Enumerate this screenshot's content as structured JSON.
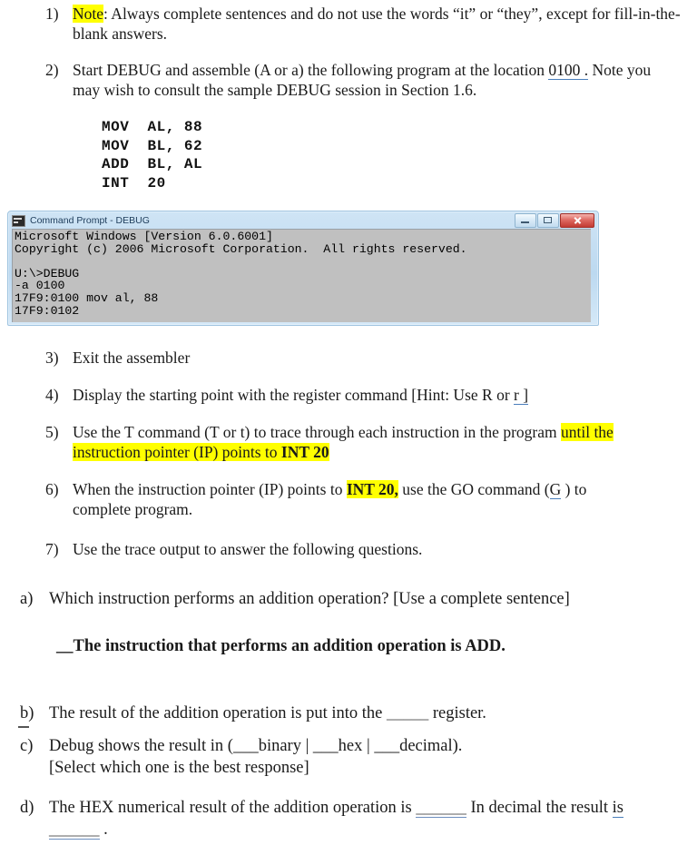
{
  "document": {
    "list_items": [
      {
        "marker": "1)",
        "segments": [
          {
            "text": "Note",
            "style": "highlight"
          },
          {
            "text": ": Always complete sentences and do not use the words “it” or “they”, except for fill-in-the-blank answers.",
            "style": "plain"
          }
        ],
        "line1": "Note: Always complete sentences and do not use the words “it” or “they”, except for fill-",
        "line2": "in-the-blank answers."
      },
      {
        "marker": "2)",
        "line1_a": "Start DEBUG and assemble (A or a) the following program at the location ",
        "line1_field": "0100 .",
        "line1_b": "  Note",
        "line2": "you may wish to consult the sample DEBUG session in Section 1.6."
      },
      {
        "marker": "3)",
        "text": "Exit the assembler"
      },
      {
        "marker": "4)",
        "text_a": "Display the starting point with the register command [Hint: Use R or ",
        "field": "r ]"
      },
      {
        "marker": "5)",
        "line1_a": "Use the T command (T or t) to trace through each instruction in the program ",
        "line1_hl": "until the",
        "line2_hl_a": "instruction pointer (IP) points to ",
        "line2_hl_b": "INT 20"
      },
      {
        "marker": "6)",
        "line1_a": "When the instruction pointer (IP) points to ",
        "line1_hl": "INT 20,",
        "line1_b": " use the GO command (",
        "line1_field": "G",
        "line1_c": " ) to",
        "line2": "complete program."
      },
      {
        "marker": "7)",
        "text": "Use the trace output to answer the following questions."
      }
    ],
    "code_block": "MOV  AL, 88\nMOV  BL, 62\nADD  BL, AL\nINT  20",
    "command_prompt": {
      "title": "Command Prompt - DEBUG",
      "icon": "console-icon",
      "minimize_label": "minimize-icon",
      "maximize_label": "maximize-icon",
      "close_label": "close-icon",
      "console_text": "Microsoft Windows [Version 6.0.6001]\nCopyright (c) 2006 Microsoft Corporation.  All rights reserved.\n\nU:\\>DEBUG\n-a 0100\n17F9:0100 mov al, 88\n17F9:0102",
      "background_color": "#c0c0c0",
      "text_color": "#000000",
      "frame_color": "#bcd9f0"
    },
    "questions": [
      {
        "marker": "a)",
        "text": "Which instruction performs an addition operation? [Use a complete sentence]",
        "answer": "__The instruction that performs an addition operation is ADD."
      },
      {
        "marker": "b)",
        "text_a": "The result of the addition operation is put into the ",
        "blank": "_____",
        "text_b": " register."
      },
      {
        "marker": "c)",
        "line1": "Debug shows the result in (___binary | ___hex | ___decimal).",
        "line2": "[Select which one is the best response]"
      },
      {
        "marker": "d)",
        "line1_a": "The HEX numerical result of the addition operation is ",
        "line1_blank": "______",
        "line1_b": "  In decimal the result ",
        "line1_field": "is",
        "line2_blank": "______",
        "line2_end": " ."
      }
    ],
    "colors": {
      "highlight": "#ffff00",
      "field_underline": "#4a7ebb",
      "text": "#1a1a1a"
    }
  }
}
